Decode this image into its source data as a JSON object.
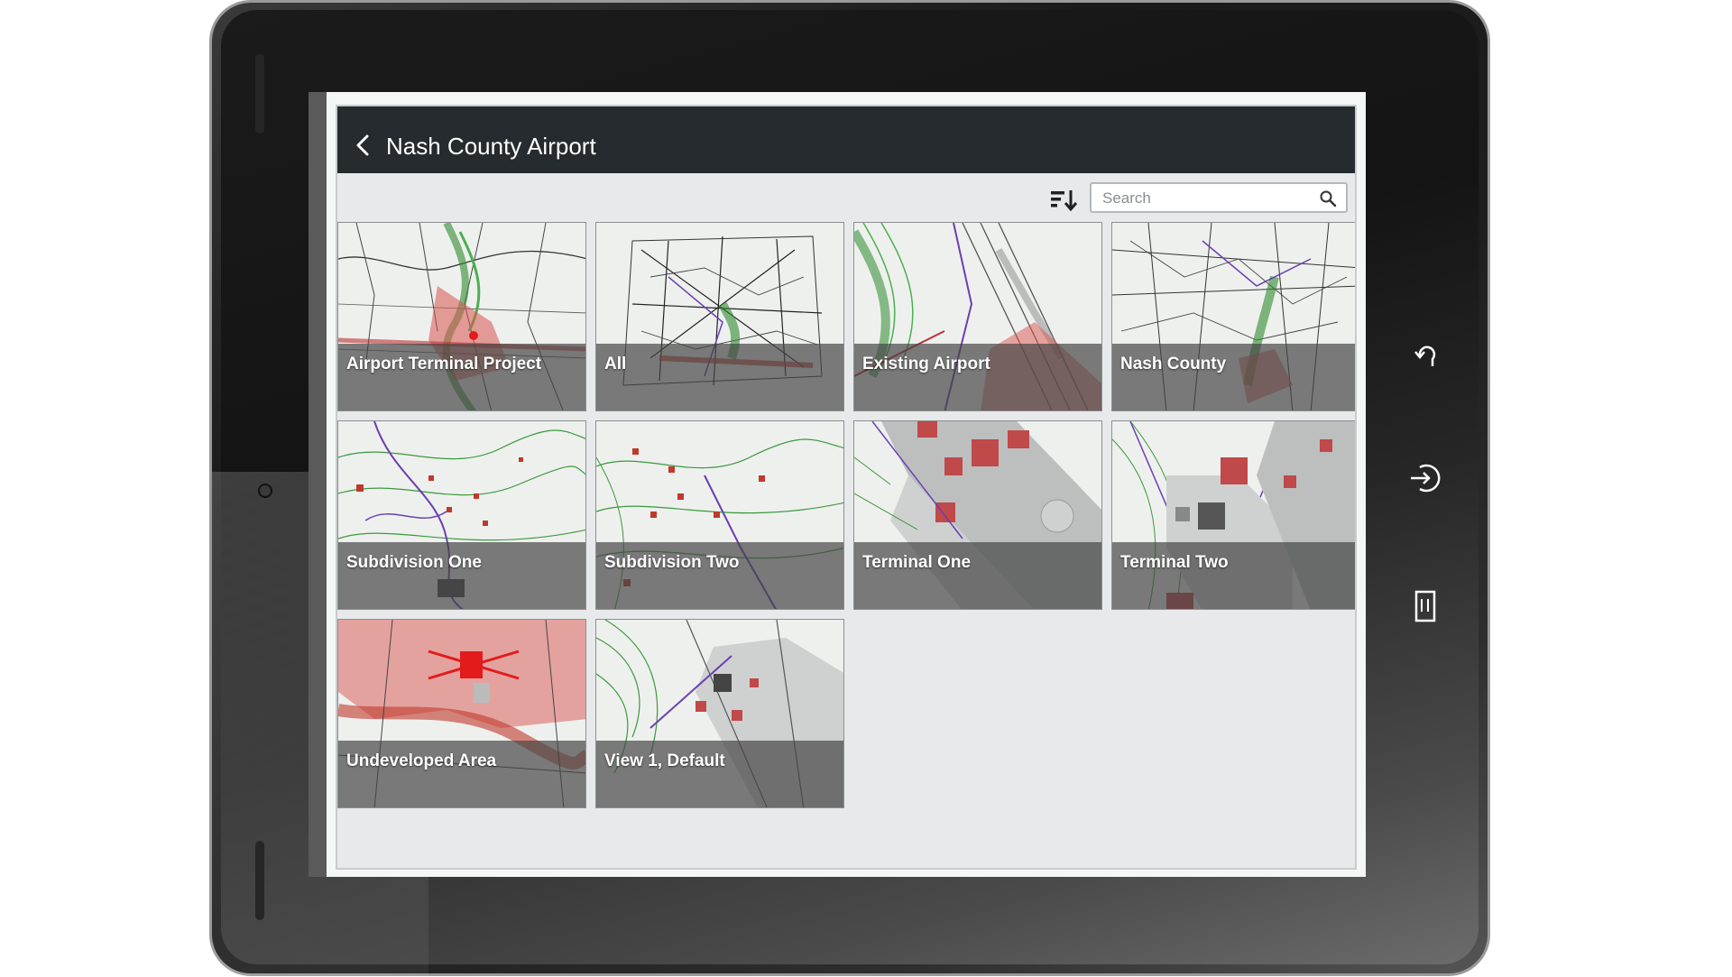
{
  "header": {
    "title": "Nash County Airport"
  },
  "search": {
    "placeholder": "Search",
    "value": ""
  },
  "tiles": [
    {
      "label": "Airport Terminal Project"
    },
    {
      "label": "All"
    },
    {
      "label": "Existing Airport"
    },
    {
      "label": "Nash County"
    },
    {
      "label": "Subdivision One"
    },
    {
      "label": "Subdivision Two"
    },
    {
      "label": "Terminal One"
    },
    {
      "label": "Terminal Two"
    },
    {
      "label": "Undeveloped Area"
    },
    {
      "label": "View 1, Default"
    }
  ],
  "icons": {
    "back": "chevron-left-icon",
    "sort": "sort-icon",
    "search": "magnifier-icon",
    "device_buttons": [
      "undo-icon",
      "exit-icon",
      "document-icon"
    ]
  },
  "colors": {
    "header_bg": "#252b2e",
    "app_bg": "#e7e9ea",
    "map_highlight": "#d9534f",
    "contour_green": "#3a9a3a",
    "road_purple": "#7a3fb0"
  }
}
